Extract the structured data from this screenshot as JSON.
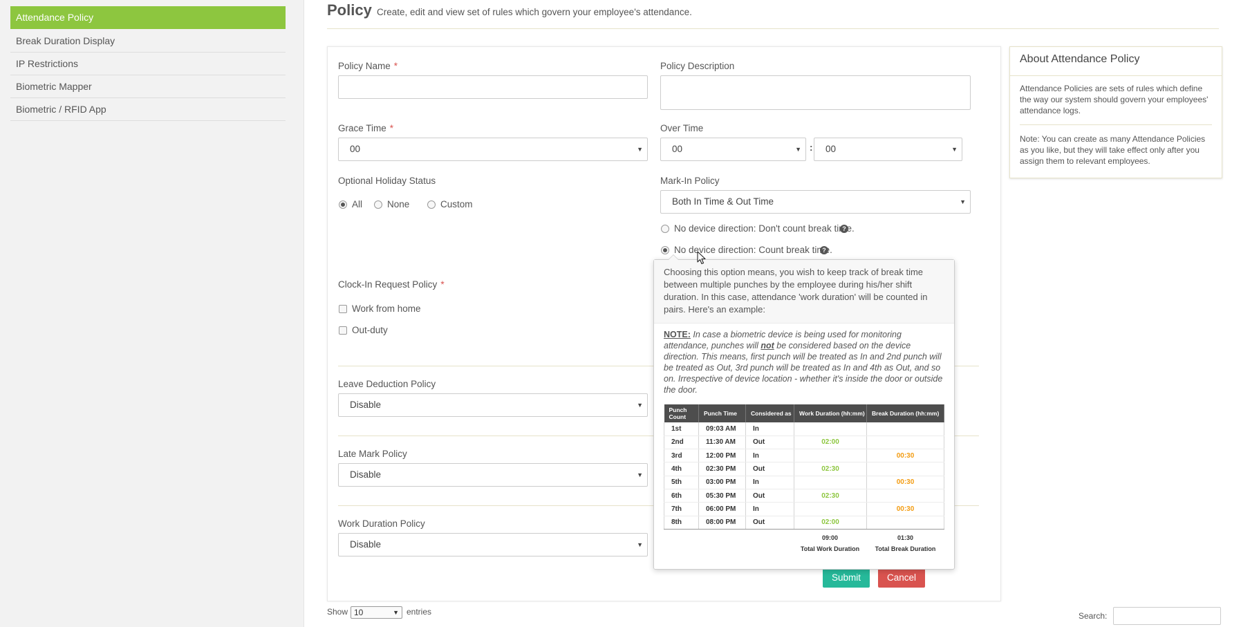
{
  "sidebar": {
    "items": [
      {
        "label": "Attendance Policy",
        "active": true
      },
      {
        "label": "Break Duration Display"
      },
      {
        "label": "IP Restrictions"
      },
      {
        "label": "Biometric Mapper"
      },
      {
        "label": "Biometric / RFID App"
      }
    ]
  },
  "header": {
    "title": "Policy",
    "subtitle": "Create, edit and view set of rules which govern your employee's attendance."
  },
  "form": {
    "policy_name_label": "Policy Name",
    "policy_name_value": "",
    "policy_description_label": "Policy Description",
    "policy_description_value": "",
    "grace_time_label": "Grace Time",
    "grace_time_value": "00",
    "over_time_label": "Over Time",
    "over_time_hours": "00",
    "over_time_separator": ":",
    "over_time_minutes": "00",
    "optional_holiday_label": "Optional Holiday Status",
    "optional_holiday_options": [
      "All",
      "None",
      "Custom"
    ],
    "optional_holiday_selected": "All",
    "mark_in_label": "Mark-In Policy",
    "mark_in_value": "Both In Time & Out Time",
    "device_option_1": "No device direction: Don't count break time.",
    "device_option_2": "No device direction: Count break time.",
    "device_selected": "No device direction: Count break time.",
    "clock_in_label": "Clock-In Request Policy",
    "clock_in_options": [
      "Work from home",
      "Out-duty"
    ],
    "leave_deduction_label": "Leave Deduction Policy",
    "leave_deduction_value": "Disable",
    "late_mark_label": "Late Mark Policy",
    "late_mark_value": "Disable",
    "work_duration_label": "Work Duration Policy",
    "work_duration_value": "Disable",
    "required_mark": "*",
    "help_glyph": "?",
    "submit_label": "Submit",
    "cancel_label": "Cancel"
  },
  "about": {
    "title": "About Attendance Policy",
    "text_1": "Attendance Policies are sets of rules which define the way our system should govern your employees' attendance logs.",
    "text_2": "Note: You can create as many Attendance Policies as you like, but they will take effect only after you assign them to relevant employees."
  },
  "popover": {
    "intro": "Choosing this option means, you wish to keep track of break time between multiple punches by the employee during his/her shift duration. In this case, attendance 'work duration' will be counted in pairs. Here's an example:",
    "note_title": "NOTE:",
    "note_pre": " In case a biometric device is being used for monitoring attendance, punches will ",
    "note_bold": "not",
    "note_post": " be considered based on the device direction. This means, first punch will be treated as In and 2nd punch will be treated as Out, 3rd punch will be treated as In and 4th as Out, and so on. Irrespective of device location - whether it's inside the door or outside the door.",
    "table_headers": [
      "Punch Count",
      "Punch Time",
      "Considered as",
      "Work Duration (hh:mm)",
      "Break Duration (hh:mm)"
    ],
    "rows": [
      [
        "1st",
        "09:03 AM",
        "In",
        "",
        ""
      ],
      [
        "2nd",
        "11:30 AM",
        "Out",
        "02:00",
        ""
      ],
      [
        "3rd",
        "12:00 PM",
        "In",
        "",
        "00:30"
      ],
      [
        "4th",
        "02:30 PM",
        "Out",
        "02:30",
        ""
      ],
      [
        "5th",
        "03:00 PM",
        "In",
        "",
        "00:30"
      ],
      [
        "6th",
        "05:30 PM",
        "Out",
        "02:30",
        ""
      ],
      [
        "7th",
        "06:00 PM",
        "In",
        "",
        "00:30"
      ],
      [
        "8th",
        "08:00 PM",
        "Out",
        "02:00",
        ""
      ]
    ],
    "total_work": "09:00",
    "total_work_label": "Total Work Duration",
    "total_break": "01:30",
    "total_break_label": "Total Break Duration"
  },
  "table_controls": {
    "show_label": "Show",
    "page_size": "10",
    "entries_label": "entries",
    "search_label": "Search:",
    "search_value": ""
  },
  "colors": {
    "accent_green": "#8dc63f",
    "submit": "#26b99a",
    "cancel": "#d9534f",
    "break_orange": "#f39c12"
  },
  "icons": {
    "dropdown": "caret-down-icon",
    "help": "question-circle-icon",
    "cursor": "mouse-pointer-icon"
  }
}
